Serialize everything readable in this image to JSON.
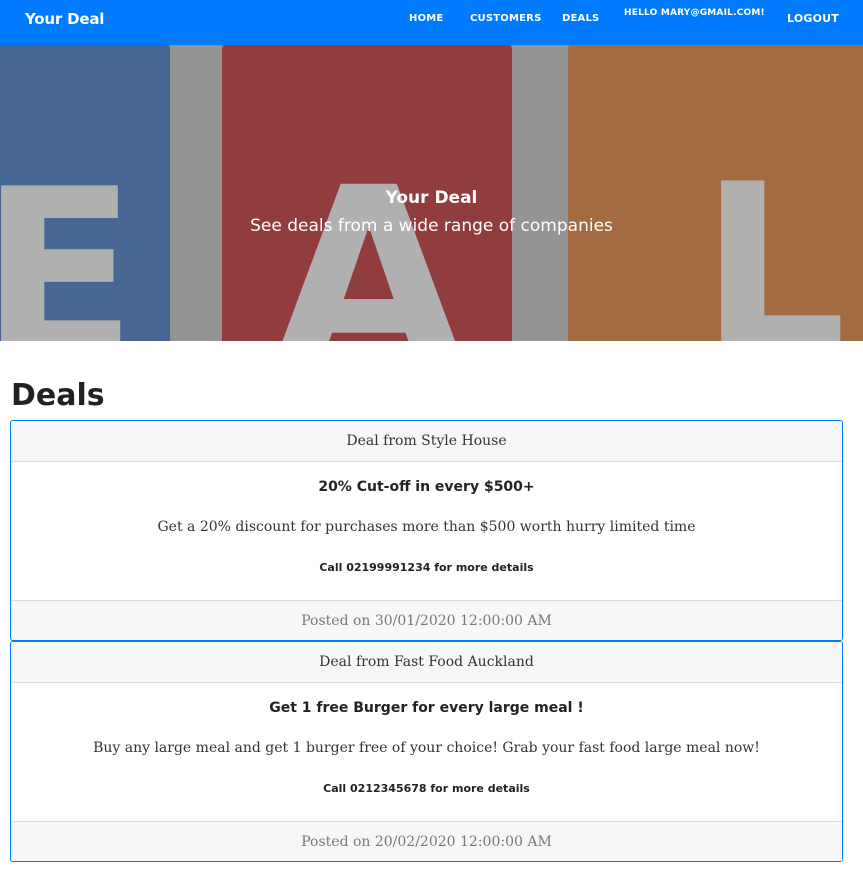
{
  "navbar": {
    "brand": "Your Deal",
    "links": [
      "HOME",
      "CUSTOMERS",
      "DEALS"
    ],
    "greeting": "HELLO MARY@GMAIL.COM!",
    "logout": "LOGOUT",
    "background": "#007bff"
  },
  "hero": {
    "title": "Your Deal",
    "subtitle": "See deals from a wide range of companies",
    "image_letters": [
      "E",
      "A",
      "L"
    ]
  },
  "page": {
    "title": "Deals"
  },
  "deals": [
    {
      "header": "Deal from Style House",
      "title": "20% Cut-off in every $500+",
      "description": "Get a 20% discount for purchases more than $500 worth hurry limited time",
      "call": "Call 02199991234 for more details",
      "posted": "Posted on 30/01/2020 12:00:00 AM"
    },
    {
      "header": "Deal from Fast Food Auckland",
      "title": "Get 1 free Burger for every large meal !",
      "description": "Buy any large meal and get 1 burger free of your choice! Grab your fast food large meal now!",
      "call": "Call 0212345678 for more details",
      "posted": "Posted on 20/02/2020 12:00:00 AM"
    }
  ]
}
